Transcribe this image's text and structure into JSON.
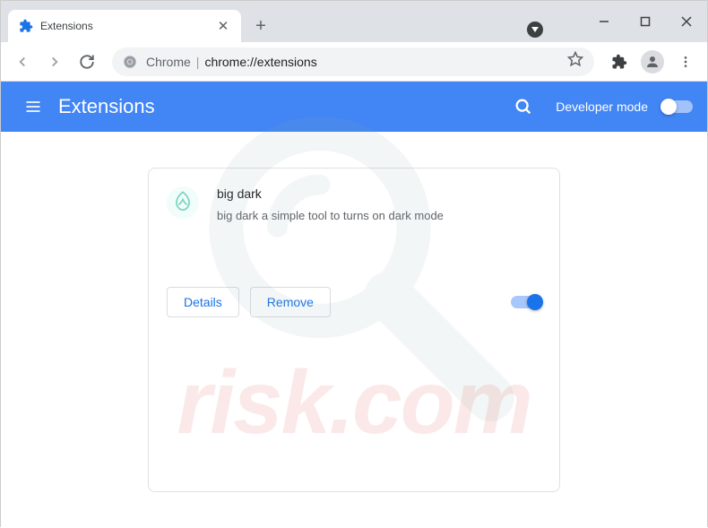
{
  "tab": {
    "title": "Extensions"
  },
  "omnibox": {
    "origin": "Chrome",
    "path": "chrome://extensions"
  },
  "header": {
    "title": "Extensions",
    "dev_mode_label": "Developer mode"
  },
  "extension": {
    "name": "big dark",
    "description": "big dark a simple tool to turns on dark mode",
    "details_label": "Details",
    "remove_label": "Remove"
  },
  "watermark": {
    "text": "risk.com"
  }
}
